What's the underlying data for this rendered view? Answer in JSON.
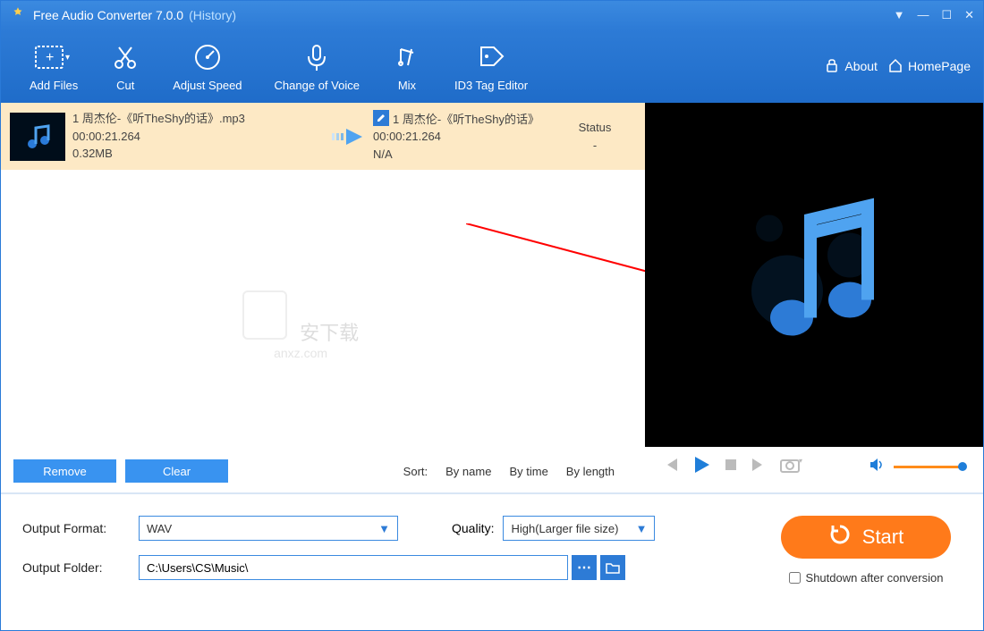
{
  "app": {
    "title": "Free Audio Converter 7.0.0",
    "history": "(History)"
  },
  "toolbar": {
    "add_files": "Add Files",
    "cut": "Cut",
    "adjust_speed": "Adjust Speed",
    "change_voice": "Change of Voice",
    "mix": "Mix",
    "id3_editor": "ID3 Tag Editor",
    "about": "About",
    "homepage": "HomePage"
  },
  "list": {
    "item": {
      "idx": "1",
      "name": "周杰伦-《听TheShy的话》.mp3",
      "duration": "00:00:21.264",
      "size": "0.32MB",
      "out_name": "周杰伦-《听TheShy的话》",
      "out_duration": "00:00:21.264",
      "out_size": "N/A",
      "status_label": "Status",
      "status_value": "-"
    }
  },
  "watermark": {
    "text": "安下载",
    "sub": "anxz.com"
  },
  "actions": {
    "remove": "Remove",
    "clear": "Clear",
    "sort_label": "Sort:",
    "by_name": "By name",
    "by_time": "By time",
    "by_length": "By length"
  },
  "bottom": {
    "format_label": "Output Format:",
    "format_value": "WAV",
    "quality_label": "Quality:",
    "quality_value": "High(Larger file size)",
    "folder_label": "Output Folder:",
    "folder_value": "C:\\Users\\CS\\Music\\",
    "start": "Start",
    "shutdown": "Shutdown after conversion"
  }
}
